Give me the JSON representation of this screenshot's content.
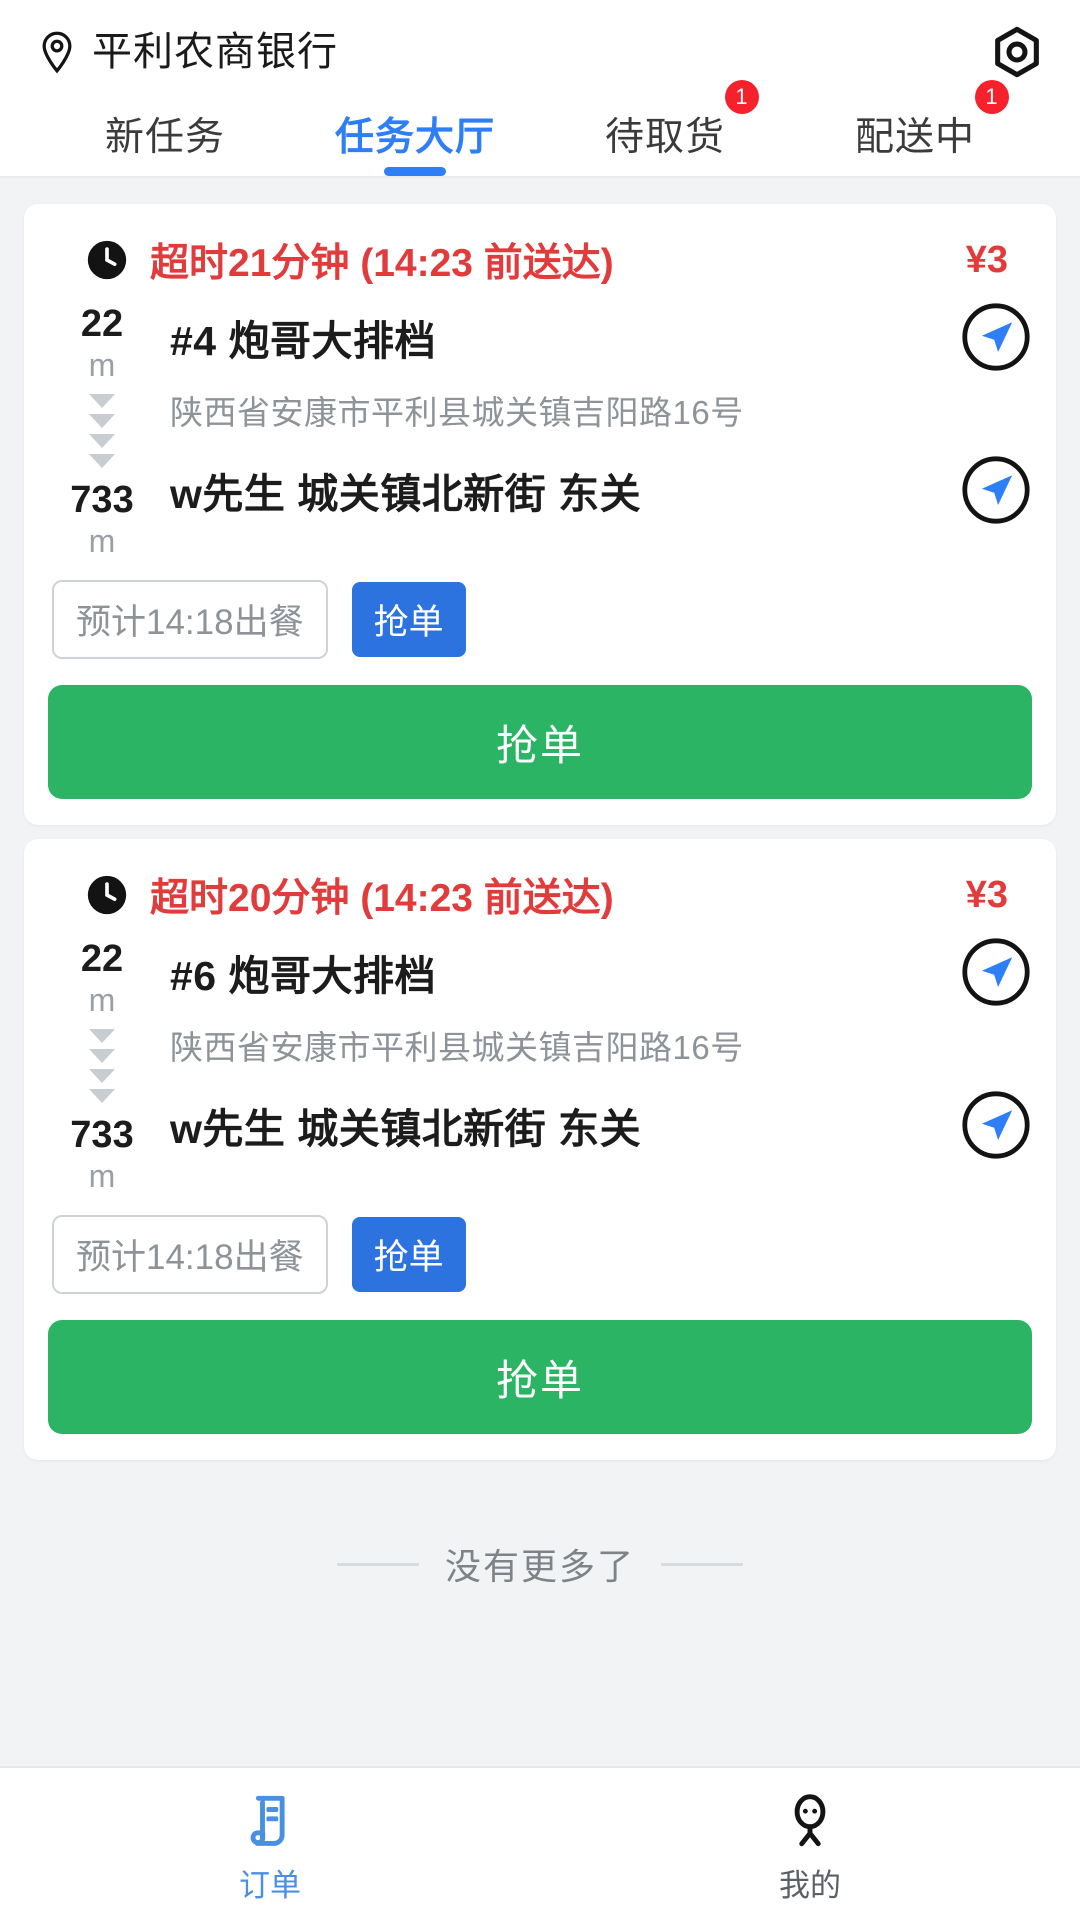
{
  "header": {
    "location_icon": "location-pin-icon",
    "shop_name": "平利农商银行",
    "right_icon": "settings-target-icon"
  },
  "tabs": [
    {
      "label": "新任务",
      "active": false,
      "badge": ""
    },
    {
      "label": "任务大厅",
      "active": true,
      "badge": ""
    },
    {
      "label": "待取货",
      "active": false,
      "badge": "1"
    },
    {
      "label": "配送中",
      "active": false,
      "badge": "1"
    }
  ],
  "colors": {
    "accent_blue": "#2d7ef7",
    "alert_red": "#e23b3b",
    "badge_red": "#f5222d",
    "grab_green": "#2bb464",
    "chip_blue": "#2d73e0",
    "muted_gray": "#8d9399"
  },
  "orders": [
    {
      "clock_icon": "clock-icon",
      "overdue": "超时21分钟 (14:23 前送达)",
      "price": "¥3",
      "pickup_distance": "22",
      "pickup_distance_unit": "m",
      "pickup_title": "#4 炮哥大排档",
      "pickup_address": "陕西省安康市平利县城关镇吉阳路16号",
      "pickup_nav_icon": "navigate-arrow-icon",
      "dropoff_distance": "733",
      "dropoff_distance_unit": "m",
      "dropoff_title": "w先生 城关镇北新街 东关",
      "dropoff_nav_icon": "navigate-arrow-icon",
      "eta": "预计14:18出餐",
      "chip_label": "抢单",
      "action_label": "抢单"
    },
    {
      "clock_icon": "clock-icon",
      "overdue": "超时20分钟 (14:23 前送达)",
      "price": "¥3",
      "pickup_distance": "22",
      "pickup_distance_unit": "m",
      "pickup_title": "#6 炮哥大排档",
      "pickup_address": "陕西省安康市平利县城关镇吉阳路16号",
      "pickup_nav_icon": "navigate-arrow-icon",
      "dropoff_distance": "733",
      "dropoff_distance_unit": "m",
      "dropoff_title": "w先生 城关镇北新街 东关",
      "dropoff_nav_icon": "navigate-arrow-icon",
      "eta": "预计14:18出餐",
      "chip_label": "抢单",
      "action_label": "抢单"
    }
  ],
  "list_end": {
    "text": "没有更多了"
  },
  "tabbar": [
    {
      "label": "订单",
      "icon": "receipt-icon",
      "active": true
    },
    {
      "label": "我的",
      "icon": "person-icon",
      "active": false
    }
  ]
}
